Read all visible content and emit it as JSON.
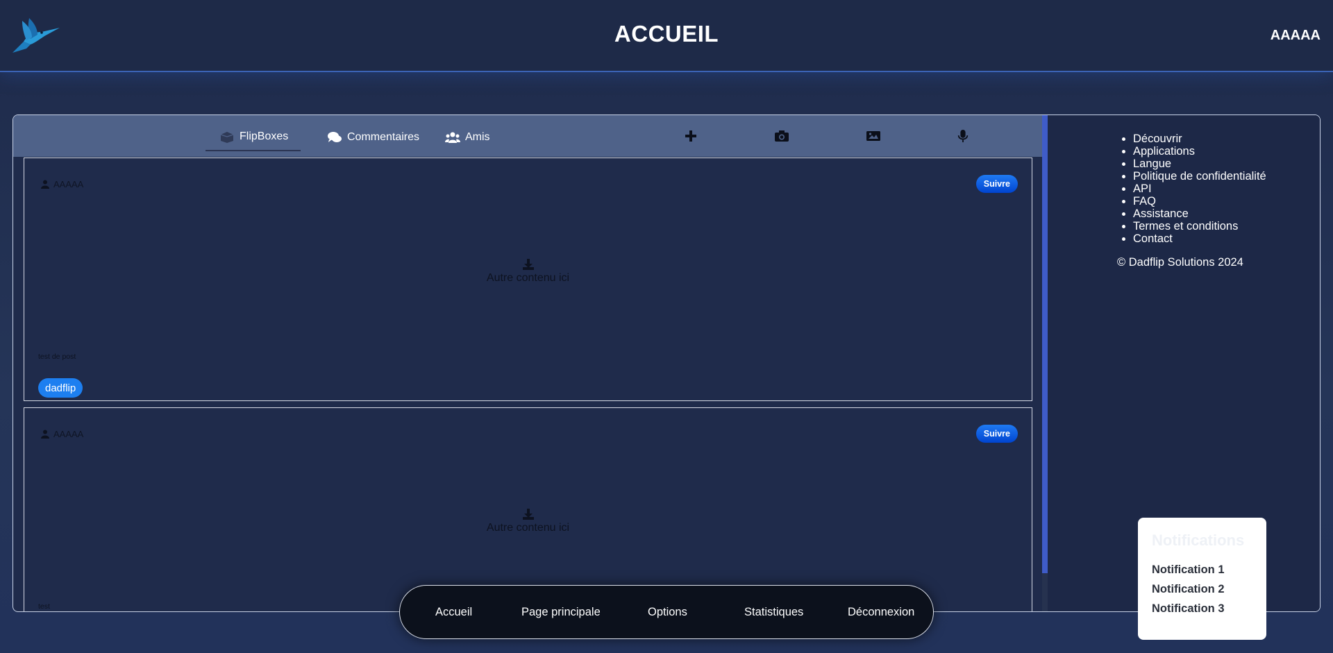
{
  "header": {
    "title": "ACCUEIL",
    "username": "AAAAA",
    "logo_icon": "hummingbird-logo-icon"
  },
  "tabs": [
    {
      "label": "FlipBoxes",
      "icon": "box-icon",
      "active": true
    },
    {
      "label": "Commentaires",
      "icon": "comments-icon",
      "active": false
    },
    {
      "label": "Amis",
      "icon": "users-icon",
      "active": false
    }
  ],
  "actions": [
    "plus-icon",
    "camera-icon",
    "image-icon",
    "microphone-icon"
  ],
  "posts": [
    {
      "author": "AAAAA",
      "follow_label": "Suivre",
      "content": "Autre contenu ici",
      "text": "test de post",
      "tag": "dadflip"
    },
    {
      "author": "AAAAA",
      "follow_label": "Suivre",
      "content": "Autre contenu ici",
      "text": "test"
    }
  ],
  "sidebar": {
    "links": [
      "Découvrir",
      "Applications",
      "Langue",
      "Politique de confidentialité",
      "API",
      "FAQ",
      "Assistance",
      "Termes et conditions",
      "Contact"
    ],
    "copyright": "© Dadflip Solutions 2024"
  },
  "notifications": {
    "title": "Notifications",
    "items": [
      "Notification 1",
      "Notification 2",
      "Notification 3"
    ]
  },
  "bottom_nav": [
    "Accueil",
    "Page principale",
    "Options",
    "Statistiques",
    "Déconnexion"
  ],
  "colors": {
    "accent": "#1d7ff0",
    "header_bg": "#1e2a48",
    "tab_bar_bg": "#4f6289",
    "panel_bg": "#1f2b4b"
  }
}
